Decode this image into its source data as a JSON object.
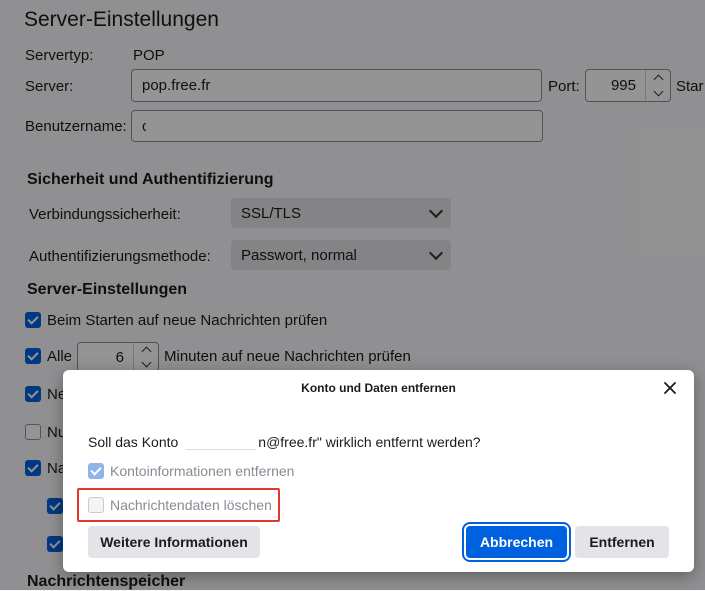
{
  "page": {
    "title": "Server-Einstellungen",
    "server_type_label": "Servertyp:",
    "server_type_value": "POP",
    "server_label": "Server:",
    "server_value": "pop.free.fr",
    "port_label": "Port:",
    "port_value": "995",
    "standard_label": "Star",
    "username_label": "Benutzername:",
    "username_value": "c",
    "security_heading": "Sicherheit und Authentifizierung",
    "conn_security_label": "Verbindungssicherheit:",
    "conn_security_value": "SSL/TLS",
    "auth_label": "Authentifizierungsmethode:",
    "auth_value": "Passwort, normal",
    "server_settings_heading": "Server-Einstellungen",
    "check_on_start": "Beim Starten auf neue Nachrichten prüfen",
    "check_every_prefix": "Alle",
    "check_every_value": "6",
    "check_every_suffix": "Minuten auf neue Nachrichten prüfen",
    "row3_partial": "Ne",
    "row4_partial": "Nu",
    "row5_partial": "Na",
    "storage_heading": "Nachrichtenspeicher"
  },
  "dialog": {
    "title": "Konto und Daten entfernen",
    "question_prefix": "Soll das Konto",
    "question_suffix": "n@free.fr\" wirklich entfernt werden?",
    "remove_account_info": "Kontoinformationen entfernen",
    "delete_message_data": "Nachrichtendaten löschen",
    "more_info_button": "Weitere Informationen",
    "cancel_button": "Abbrechen",
    "remove_button": "Entfernen"
  },
  "colors": {
    "accent": "#0061e0",
    "highlight_border": "#e0392b",
    "overlay": "rgba(0,0,0,0.42)"
  }
}
